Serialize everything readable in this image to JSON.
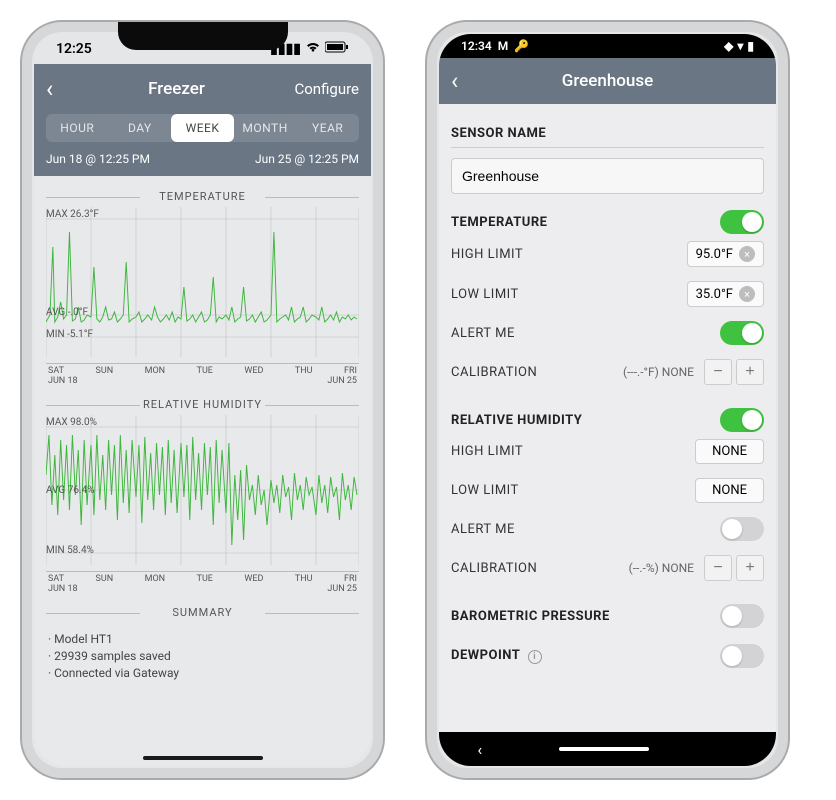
{
  "left": {
    "status_time": "12:25",
    "nav": {
      "title": "Freezer",
      "right": "Configure"
    },
    "tabs": [
      "HOUR",
      "DAY",
      "WEEK",
      "MONTH",
      "YEAR"
    ],
    "active_tab": "WEEK",
    "range": {
      "start": "Jun 18 @ 12:25 PM",
      "end": "Jun 25 @ 12:25 PM"
    },
    "sections": {
      "temperature": {
        "title": "TEMPERATURE",
        "max": "MAX 26.3°F",
        "avg": "AVG -.0°F",
        "min": "MIN -5.1°F",
        "xaxis_days": [
          "SAT",
          "SUN",
          "MON",
          "TUE",
          "WED",
          "THU",
          "FRI"
        ],
        "xaxis_start": "JUN 18",
        "xaxis_end": "JUN 25"
      },
      "humidity": {
        "title": "RELATIVE HUMIDITY",
        "max": "MAX 98.0%",
        "avg": "AVG 76.4%",
        "min": "MIN 58.4%",
        "xaxis_days": [
          "SAT",
          "SUN",
          "MON",
          "TUE",
          "WED",
          "THU",
          "FRI"
        ],
        "xaxis_start": "JUN 18",
        "xaxis_end": "JUN 25"
      },
      "summary": {
        "title": "SUMMARY",
        "items": [
          "· Model HT1",
          "· 29939 samples saved",
          "· Connected via Gateway"
        ]
      }
    }
  },
  "right": {
    "status_time": "12:34",
    "nav": {
      "title": "Greenhouse"
    },
    "sensor_name_label": "SENSOR NAME",
    "sensor_name_value": "Greenhouse",
    "temperature": {
      "label": "TEMPERATURE",
      "high_limit_label": "HIGH LIMIT",
      "high_limit_value": "95.0°F",
      "low_limit_label": "LOW LIMIT",
      "low_limit_value": "35.0°F",
      "alert_label": "ALERT ME",
      "calibration_label": "CALIBRATION",
      "calibration_value": "(---.-°F) NONE"
    },
    "humidity": {
      "label": "RELATIVE HUMIDITY",
      "high_limit_label": "HIGH LIMIT",
      "high_limit_value": "NONE",
      "low_limit_label": "LOW LIMIT",
      "low_limit_value": "NONE",
      "alert_label": "ALERT ME",
      "calibration_label": "CALIBRATION",
      "calibration_value": "(--.-%) NONE"
    },
    "barometric_label": "BAROMETRIC PRESSURE",
    "dewpoint_label": "DEWPOINT"
  },
  "chart_data": [
    {
      "type": "line",
      "title": "TEMPERATURE",
      "ylabel": "°F",
      "ylim": [
        -5.1,
        26.3
      ],
      "stats": {
        "max": 26.3,
        "avg": 0.0,
        "min": -5.1
      },
      "categories": [
        "SAT",
        "SUN",
        "MON",
        "TUE",
        "WED",
        "THU",
        "FRI"
      ],
      "x_start": "JUN 18",
      "x_end": "JUN 25",
      "note": "Dense weekly line; baseline near AVG 0°F with frequent spikes toward MAX 26.3°F; dips to MIN -5.1°F"
    },
    {
      "type": "line",
      "title": "RELATIVE HUMIDITY",
      "ylabel": "%",
      "ylim": [
        58.4,
        98.0
      ],
      "stats": {
        "max": 98.0,
        "avg": 76.4,
        "min": 58.4
      },
      "categories": [
        "SAT",
        "SUN",
        "MON",
        "TUE",
        "WED",
        "THU",
        "FRI"
      ],
      "x_start": "JUN 18",
      "x_end": "JUN 25",
      "note": "Dense weekly line oscillating mostly between ~60% and ~98%, centered around AVG 76.4%"
    }
  ]
}
